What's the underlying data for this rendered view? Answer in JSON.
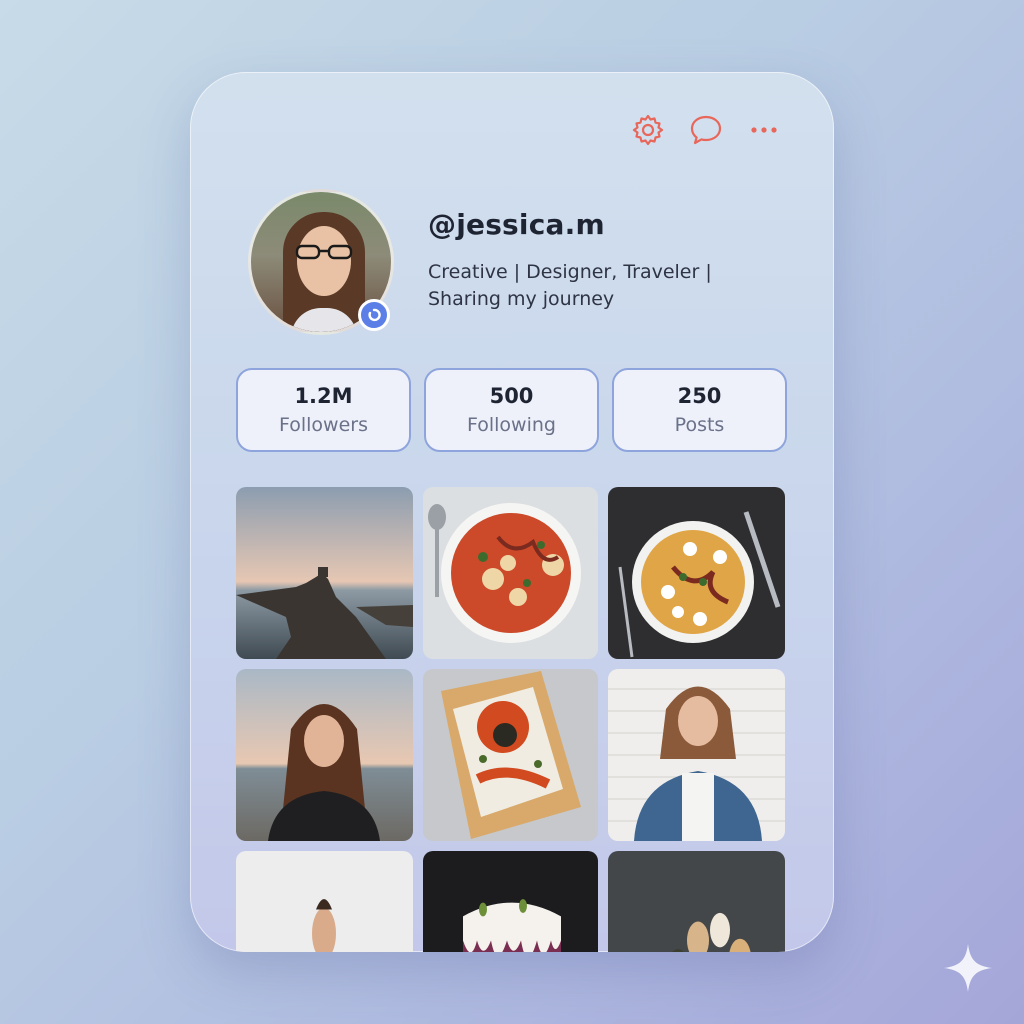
{
  "header": {
    "icons": [
      "gear-icon",
      "chat-bubble-icon",
      "more-dots-icon"
    ],
    "accent": "#e8675a"
  },
  "profile": {
    "username": "@jessica.m",
    "bio_line1": "Creative | Designer, Traveler |",
    "bio_line2": "Sharing my journey",
    "verified": true
  },
  "stats": [
    {
      "value": "1.2M",
      "label": "Followers"
    },
    {
      "value": "500",
      "label": "Following"
    },
    {
      "value": "250",
      "label": "Posts"
    }
  ],
  "posts": [
    "seaside-rock-photo",
    "pasta-bowl-photo",
    "curry-bowl-photo",
    "beach-portrait-photo",
    "flatbread-pizza-photo",
    "denim-jacket-portrait-photo",
    "thumbs-up-portrait-photo",
    "layered-cake-photo",
    "pastry-basket-photo"
  ],
  "colors": {
    "stat_border": "#8ea4dc",
    "verified_badge": "#5b7fe6"
  }
}
